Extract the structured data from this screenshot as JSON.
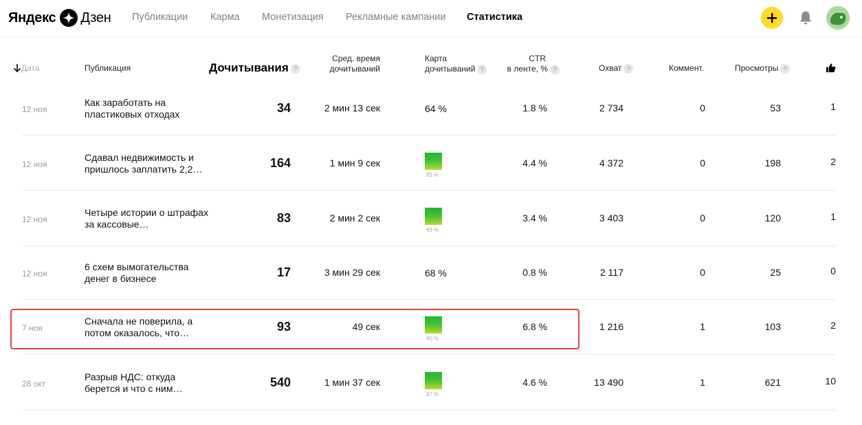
{
  "logo": {
    "yandex": "Яндекс",
    "zen": "Дзен"
  },
  "nav": [
    {
      "label": "Публикации",
      "active": false
    },
    {
      "label": "Карма",
      "active": false
    },
    {
      "label": "Монетизация",
      "active": false
    },
    {
      "label": "Рекламные кампании",
      "active": false
    },
    {
      "label": "Статистика",
      "active": true
    }
  ],
  "header_icons": {
    "add": "plus-icon",
    "notifications": "bell-icon",
    "profile": "avatar"
  },
  "columns": {
    "date": "Дата",
    "publication": "Публикация",
    "reads": "Дочитывания",
    "avg_time_line1": "Сред. время",
    "avg_time_line2": "дочитываний",
    "map_line1": "Карта",
    "map_line2": "дочитываний",
    "ctr_line1": "CTR",
    "ctr_line2": "в ленте, %",
    "reach": "Охват",
    "comments": "Коммент.",
    "views": "Просмотры",
    "likes_icon": "thumbs-up-icon",
    "help_glyph": "?"
  },
  "rows": [
    {
      "date": "12 ноя",
      "title": "Как заработать на пластиковых отходах",
      "reads": "34",
      "avg_time": "2 мин 13 сек",
      "map_type": "text",
      "map_value": "64 %",
      "ctr": "1.8 %",
      "reach": "2 734",
      "comments": "0",
      "views": "53",
      "likes": "1"
    },
    {
      "date": "12 ноя",
      "title": "Сдавал недвижимость и пришлось заплатить 2,2…",
      "reads": "164",
      "avg_time": "1 мин 9 сек",
      "map_type": "heat",
      "map_value": "83 %",
      "ctr": "4.4 %",
      "reach": "4 372",
      "comments": "0",
      "views": "198",
      "likes": "2"
    },
    {
      "date": "12 ноя",
      "title": "Четыре истории о штрафах за кассовые…",
      "reads": "83",
      "avg_time": "2 мин 2 сек",
      "map_type": "heat",
      "map_value": "69 %",
      "ctr": "3.4 %",
      "reach": "3 403",
      "comments": "0",
      "views": "120",
      "likes": "1"
    },
    {
      "date": "12 ноя",
      "title": "6 схем вымогательства денег в бизнесе",
      "reads": "17",
      "avg_time": "3 мин 29 сек",
      "map_type": "text",
      "map_value": "68 %",
      "ctr": "0.8 %",
      "reach": "2 117",
      "comments": "0",
      "views": "25",
      "likes": "0"
    },
    {
      "date": "7 ноя",
      "title": "Сначала не поверила, а потом оказалось, что…",
      "reads": "93",
      "avg_time": "49 сек",
      "map_type": "heat",
      "map_value": "90 %",
      "ctr": "6.8 %",
      "reach": "1 216",
      "comments": "1",
      "views": "103",
      "likes": "2",
      "highlighted": true
    },
    {
      "date": "28 окт",
      "title": "Разрыв НДС: откуда берется и что с ним…",
      "reads": "540",
      "avg_time": "1 мин 37 сек",
      "map_type": "heat",
      "map_value": "87 %",
      "ctr": "4.6 %",
      "reach": "13 490",
      "comments": "1",
      "views": "621",
      "likes": "10"
    }
  ],
  "colors": {
    "accent_yellow": "#ffdb28",
    "highlight_red": "#e0413a",
    "heat_green": "#23b531",
    "heat_yellow": "#b6db2d"
  }
}
